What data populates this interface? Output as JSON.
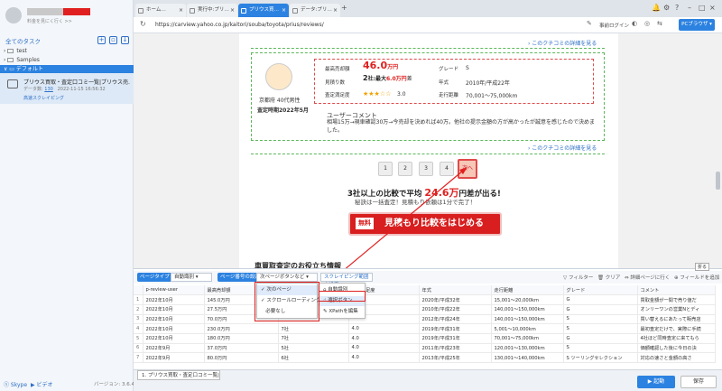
{
  "sidebar": {
    "account_label": "料金を見にく行く >>",
    "all_tasks": "全てのタスク",
    "folders": [
      "test",
      "Samples"
    ],
    "default_folder": "デフォルト",
    "task": {
      "title": "プリウス買取・査定口コミ一覧|プリウス売…",
      "data_label": "データ数:",
      "count": "130",
      "timestamp": "2022-11-15 16:56:32",
      "action": "高速スクレイピング"
    },
    "footer": {
      "skype": "Skype",
      "video": "ビデオ",
      "version": "バージョン: 3.6.4"
    }
  },
  "tabs": [
    {
      "label": "ホーム…",
      "active": false
    },
    {
      "label": "実行中:プリ…",
      "active": false
    },
    {
      "label": "プリウス買…",
      "active": true
    },
    {
      "label": "データ:プリ…",
      "active": false
    }
  ],
  "addressbar": {
    "url": "https://carview.yahoo.co.jp/kaitori/souba/toyota/prius/reviews/",
    "login": "事前ログイン",
    "pc_browser": "PCブラウザ"
  },
  "review": {
    "more_link": "› このクチコミの詳細を見る",
    "profile": "京都府 40代男性",
    "assessed": "査定時期2022年5月",
    "labels": {
      "max": "最高売却額",
      "quotes": "見積り数",
      "satisfaction": "査定満足度",
      "grade": "グレード",
      "year": "年式",
      "mileage": "走行距離"
    },
    "price": "46.0",
    "price_unit": "万円",
    "quote_count": "2",
    "quote_text": "社:最大",
    "quote_diff": "6.0万円",
    "quote_suffix": "差",
    "stars": "★★★☆☆",
    "rating": "3.0",
    "grade": "S",
    "year": "2010年/平成22年",
    "mileage": "70,001〜75,000km",
    "comment_title": "ユーザーコメント",
    "comment": "相場15万→現車確認30万→今売却を決めれば40万。他社の提示金額の方が高かったが誠意を感じたので決めました。"
  },
  "pagination": {
    "pages": [
      "1",
      "2",
      "3",
      "4"
    ],
    "next": "次へ"
  },
  "promo": {
    "headline_a": "3社以上の比較で平均",
    "headline_big": "24.6万",
    "headline_b": "円差が出る!",
    "subline": "秘訣は一括査定！見積もり依頼は1分で完了！",
    "cta_tag": "無料",
    "cta_text": "見積もり比較をはじめる",
    "section": "車買取査定のお役立ち情報"
  },
  "toolbar": {
    "page_type": "ページタイプ",
    "auto_detect": "自動識別",
    "paging": "ページ番号の設定",
    "paging_value": "次ページボタンなど",
    "scrape_range": "スクレイピング範囲を設定",
    "filter": "フィルター",
    "clear": "クリア",
    "detail": "詳細ページに行く",
    "add_field": "フィールドを追加",
    "collapse": "折る"
  },
  "dropdown1": [
    "次のページ",
    "スクロールローディング",
    "必要なし"
  ],
  "dropdown2": [
    "自動識別",
    "選択ボタン",
    "XPathを編集"
  ],
  "table": {
    "headers": [
      "",
      "p-review-user",
      "最高売却額",
      "",
      "査定満足度",
      "年式",
      "走行距離",
      "グレード",
      "コメント"
    ],
    "rows": [
      [
        "1",
        "2022年10月",
        "145.0万円",
        "",
        "",
        "2020年/平成32年",
        "15,001～20,000km",
        "G",
        "買取金額が一間で売り値だ"
      ],
      [
        "2",
        "2022年10月",
        "27.5万円",
        "",
        "",
        "2010年/平成22年",
        "140,001～150,000km",
        "G",
        "オンリーワンの営業Nとディ"
      ],
      [
        "3",
        "2022年10月",
        "70.0万円",
        "",
        "",
        "2012年/平成24年",
        "140,001～150,000km",
        "S",
        "買い替えるにあたって販売店"
      ],
      [
        "4",
        "2022年10月",
        "230.0万円",
        "7社",
        "4.0",
        "2019年/平成31年",
        "5,001～10,000km",
        "S",
        "最初査定だけで、実際に手続"
      ],
      [
        "5",
        "2022年10月",
        "180.0万円",
        "7社",
        "4.0",
        "2019年/平成31年",
        "70,001～75,000km",
        "G",
        "4社ほど同時査定に来てもら"
      ],
      [
        "6",
        "2022年9月",
        "37.0万円",
        "5社",
        "4.0",
        "2011年/平成23年",
        "120,001～130,000km",
        "S",
        "価額確認した後に今日の決"
      ],
      [
        "7",
        "2022年9月",
        "80.0万円",
        "6社",
        "4.0",
        "2013年/平成25年",
        "130,001～140,000km",
        "S ツーリングセレクション",
        "対応の速さと金額の高さ"
      ]
    ]
  },
  "footer": {
    "tab": "1. プリウス買取・査定口コミ一覧|…",
    "run": "▶ 起動",
    "save": "保存"
  }
}
